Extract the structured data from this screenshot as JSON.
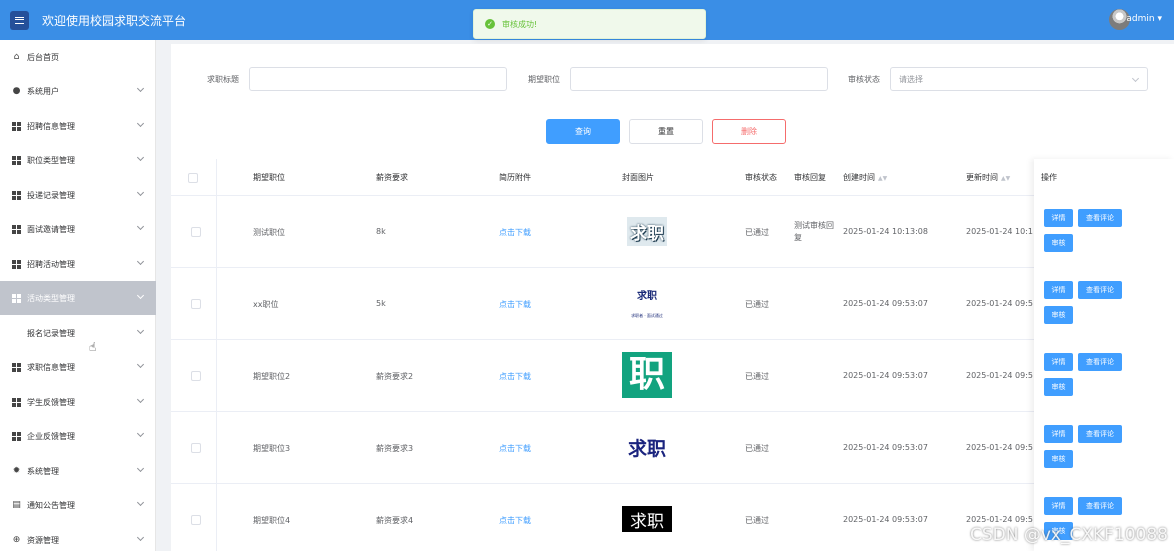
{
  "header": {
    "title": "欢迎使用校园求职交流平台",
    "user": "admin",
    "user_caret": "▾"
  },
  "toast": {
    "text": "审核成功!",
    "icon": "✓"
  },
  "sidebar": {
    "items": [
      {
        "label": "后台首页",
        "icon": "home-icon",
        "has_chevron": false
      },
      {
        "label": "系统用户",
        "icon": "user-icon",
        "has_chevron": true
      },
      {
        "label": "招聘信息管理",
        "icon": "grid-icon",
        "has_chevron": true
      },
      {
        "label": "职位类型管理",
        "icon": "grid-icon",
        "has_chevron": true
      },
      {
        "label": "投递记录管理",
        "icon": "grid-icon",
        "has_chevron": true
      },
      {
        "label": "面试邀请管理",
        "icon": "grid-icon",
        "has_chevron": true
      },
      {
        "label": "招聘活动管理",
        "icon": "grid-icon",
        "has_chevron": true
      },
      {
        "label": "活动类型管理",
        "icon": "grid-icon",
        "has_chevron": true,
        "active": true
      },
      {
        "label": "报名记录管理",
        "icon": "",
        "has_chevron": true,
        "sub": true
      },
      {
        "label": "求职信息管理",
        "icon": "grid-icon",
        "has_chevron": true
      },
      {
        "label": "学生反馈管理",
        "icon": "grid-icon",
        "has_chevron": true
      },
      {
        "label": "企业反馈管理",
        "icon": "grid-icon",
        "has_chevron": true
      },
      {
        "label": "系统管理",
        "icon": "gear-icon",
        "has_chevron": true
      },
      {
        "label": "通知公告管理",
        "icon": "document-icon",
        "has_chevron": true
      },
      {
        "label": "资源管理",
        "icon": "plus-circle-icon",
        "has_chevron": true
      }
    ]
  },
  "filters": {
    "title_label": "求职标题",
    "title_value": "",
    "position_label": "期望职位",
    "position_value": "",
    "status_label": "审核状态",
    "status_placeholder": "请选择"
  },
  "actions": {
    "query": "查询",
    "reset": "重置",
    "delete": "删除"
  },
  "table": {
    "headers": {
      "position": "期望职位",
      "salary": "薪资要求",
      "attachment": "简历附件",
      "cover": "封面图片",
      "status": "审核状态",
      "reply": "审核回复",
      "created": "创建时间",
      "updated": "更新时间",
      "ops": "操作"
    },
    "rows": [
      {
        "position": "测试职位",
        "salary": "8k",
        "attachment": "点击下载",
        "cover_text": "求职",
        "status": "已通过",
        "reply": "测试审核回复",
        "created": "2025-01-24 10:13:08",
        "updated": "2025-01-24 10:1"
      },
      {
        "position": "xx职位",
        "salary": "5k",
        "attachment": "点击下载",
        "cover_text": "求职",
        "cover_sub": "求职者 · 面试通过",
        "status": "已通过",
        "reply": "",
        "created": "2025-01-24 09:53:07",
        "updated": "2025-01-24 09:5"
      },
      {
        "position": "期望职位2",
        "salary": "薪资要求2",
        "attachment": "点击下载",
        "cover_text": "职",
        "status": "已通过",
        "reply": "",
        "created": "2025-01-24 09:53:07",
        "updated": "2025-01-24 09:5"
      },
      {
        "position": "期望职位3",
        "salary": "薪资要求3",
        "attachment": "点击下载",
        "cover_text": "求职",
        "status": "已通过",
        "reply": "",
        "created": "2025-01-24 09:53:07",
        "updated": "2025-01-24 09:5"
      },
      {
        "position": "期望职位4",
        "salary": "薪资要求4",
        "attachment": "点击下载",
        "cover_text": "求职",
        "status": "已通过",
        "reply": "",
        "created": "2025-01-24 09:53:07",
        "updated": "2025-01-24 09:5"
      }
    ],
    "op_buttons": {
      "detail": "详情",
      "comments": "查看评论",
      "audit": "审核"
    }
  },
  "watermark": "CSDN @vx_CXKF10088",
  "colors": {
    "primary": "#409eff",
    "topbar": "#3a8ee6",
    "danger": "#f56c6c",
    "success": "#67c23a"
  }
}
